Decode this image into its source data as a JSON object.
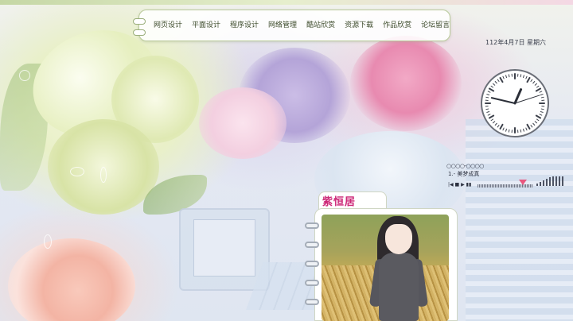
{
  "nav": {
    "items": [
      {
        "label": "网页设计"
      },
      {
        "label": "平面设计"
      },
      {
        "label": "程序设计"
      },
      {
        "label": "网络管理"
      },
      {
        "label": "酷站欣赏"
      },
      {
        "label": "资源下载"
      },
      {
        "label": "作品欣赏"
      },
      {
        "label": "论坛留言"
      }
    ]
  },
  "date": {
    "text": "112年4月7日  星期六"
  },
  "clock": {
    "hour": 12,
    "minute": 47,
    "second": 12
  },
  "player": {
    "header": "○○○○-○○○○",
    "track": "1.‐ 美梦成真",
    "controls": "|◀ ■ ▶ ▮▮",
    "progress": 0.82
  },
  "album": {
    "title": "紫恒居"
  },
  "colors": {
    "accent": "#cc2a78",
    "nav_border": "#b9c99a",
    "knob": "#e9577f"
  }
}
